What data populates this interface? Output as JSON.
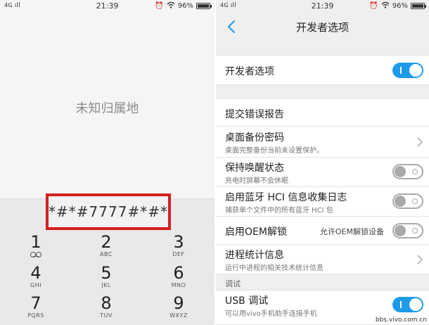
{
  "status_left": {
    "network": "4G",
    "time": "21:39",
    "battery": "96%",
    "battery_level": 0.96
  },
  "status_right": {
    "network": "4G",
    "time": "21:39",
    "battery": "96%",
    "battery_level": 0.96
  },
  "dialer": {
    "location_text": "未知归属地",
    "input_value": "*#*#7777#*#*",
    "keys": [
      {
        "num": "1",
        "sub": ""
      },
      {
        "num": "2",
        "sub": "ABC"
      },
      {
        "num": "3",
        "sub": "DEF"
      },
      {
        "num": "4",
        "sub": "GHI"
      },
      {
        "num": "5",
        "sub": "JKL"
      },
      {
        "num": "6",
        "sub": "MNO"
      },
      {
        "num": "7",
        "sub": "PQRS"
      },
      {
        "num": "8",
        "sub": "TUV"
      },
      {
        "num": "9",
        "sub": "WXYZ"
      }
    ]
  },
  "dev_options": {
    "header_title": "开发者选项",
    "master": {
      "label": "开发者选项",
      "on": true
    },
    "bug_report": {
      "label": "提交错误报告"
    },
    "backup_password": {
      "label": "桌面备份密码",
      "desc": "桌面完整备份当前未设置保护。"
    },
    "stay_awake": {
      "label": "保持唤醒状态",
      "desc": "充电时屏幕不会休眠",
      "on": false
    },
    "bt_hci_log": {
      "label": "启用蓝牙 HCI 信息收集日志",
      "desc": "捕获单个文件中的所有蓝牙 HCI 包",
      "on": false
    },
    "oem_unlock": {
      "label": "启用OEM解锁",
      "side": "允许OEM解锁设备",
      "on": false
    },
    "process_stats": {
      "label": "进程统计信息",
      "desc": "运行中进程的相关技术统计信息"
    },
    "debug_section": "调试",
    "usb_debug": {
      "label": "USB 调试",
      "desc": "可以用vivo手机助手连接手机",
      "on": true
    }
  },
  "watermark": "bbs.vivo.com.cn",
  "colors": {
    "accent": "#1e9be8",
    "highlight_box": "#d42020",
    "toggle_off": "#a9a9a9"
  }
}
